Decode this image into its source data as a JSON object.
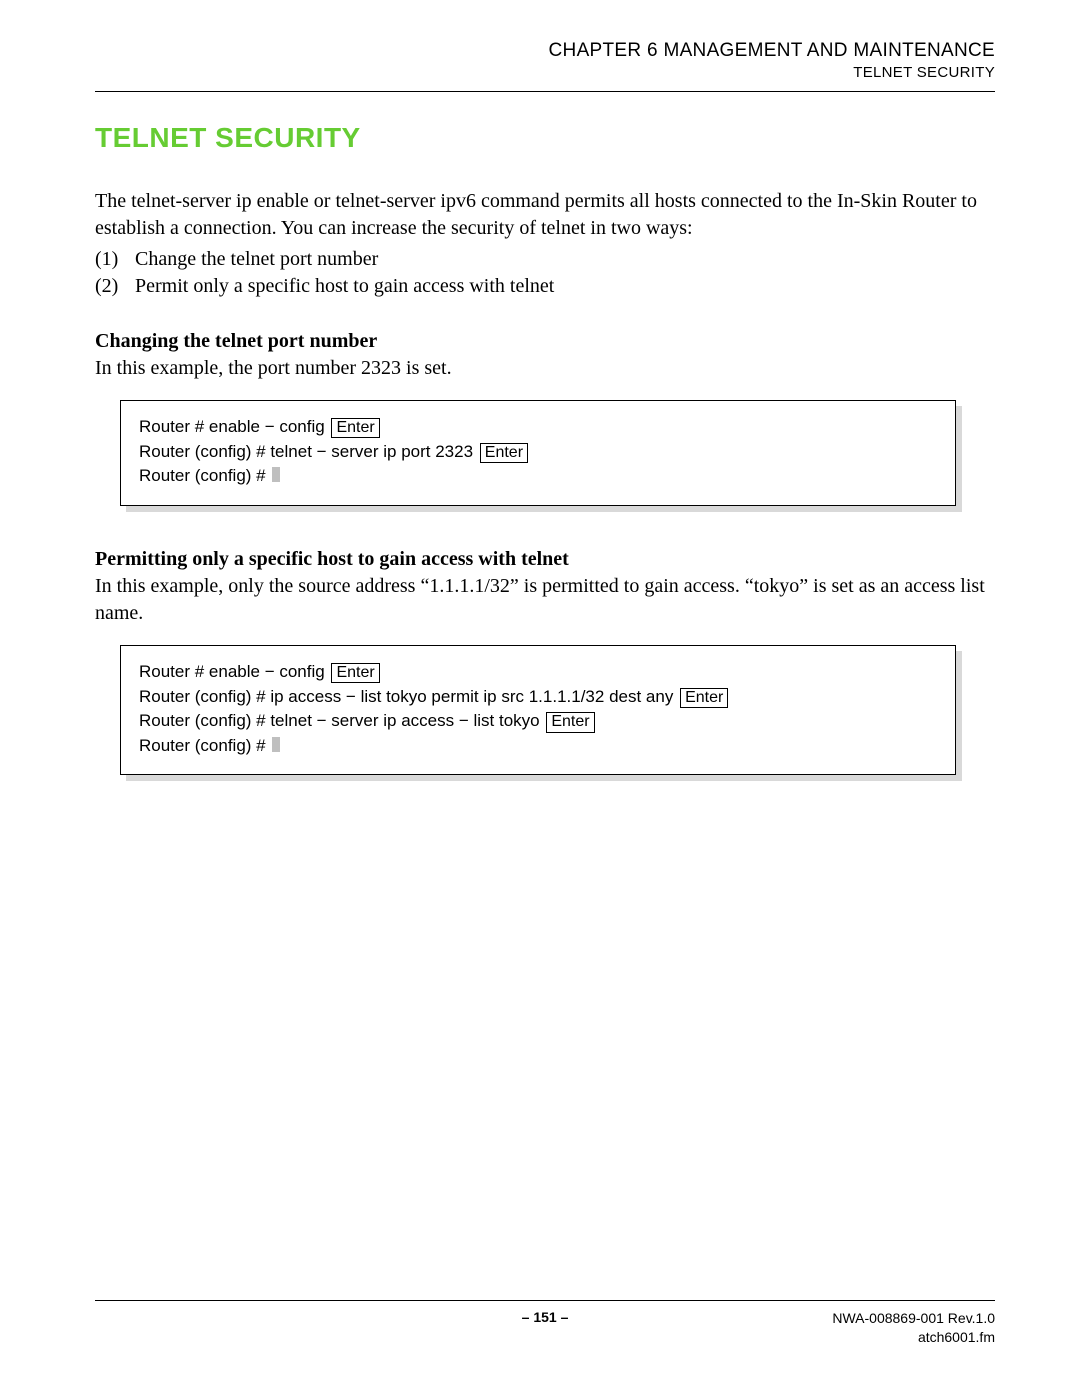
{
  "header": {
    "chapter": "CHAPTER 6   MANAGEMENT AND MAINTENANCE",
    "section": "TELNET SECURITY"
  },
  "title": "TELNET SECURITY",
  "intro": "The telnet-server ip enable or telnet-server ipv6 command permits all hosts connected to the In-Skin Router to establish a connection. You can increase the security of telnet in two ways:",
  "list": [
    "Change the telnet port number",
    "Permit only a specific host to gain access with telnet"
  ],
  "section1": {
    "heading": "Changing the telnet port number",
    "text": "In this example, the port number 2323 is set.",
    "code": {
      "line1_pre": "Router #  enable − config",
      "line1_key": "Enter",
      "line2_pre": "Router (config) # telnet − server ip port 2323",
      "line2_key": "Enter",
      "line3_pre": "Router (config) #"
    }
  },
  "section2": {
    "heading": "Permitting only a specific host to gain access with telnet",
    "text": "In this example, only the source address “1.1.1.1/32” is permitted to gain access. “tokyo” is set as an access list name.",
    "code": {
      "line1_pre": "Router #  enable − config",
      "line1_key": "Enter",
      "line2_pre": "Router (config) # ip access − list tokyo permit ip src 1.1.1.1/32 dest any",
      "line2_key": "Enter",
      "line3_pre": "Router (config) # telnet − server ip access − list tokyo",
      "line3_key": "Enter",
      "line4_pre": "Router (config) #"
    }
  },
  "footer": {
    "page": "– 151 –",
    "doc": "NWA-008869-001 Rev.1.0",
    "file": "atch6001.fm"
  }
}
